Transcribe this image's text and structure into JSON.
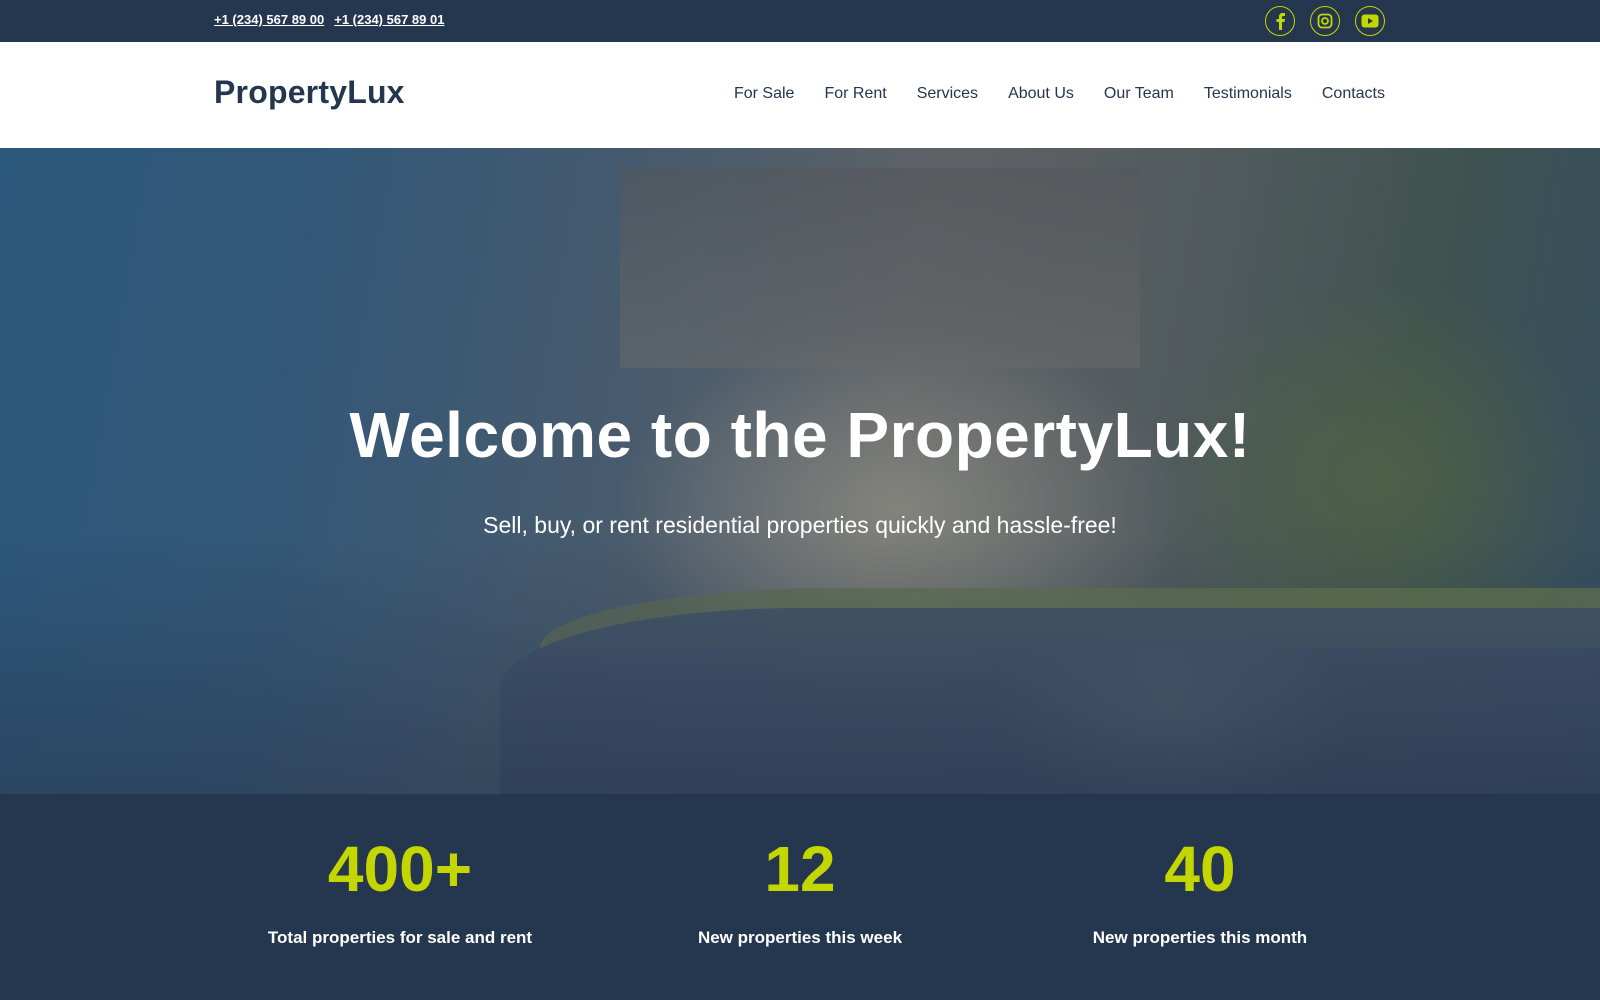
{
  "topbar": {
    "phones": [
      "+1 (234) 567 89 00",
      "+1 (234) 567 89 01"
    ],
    "socials": [
      {
        "name": "facebook",
        "icon": "facebook-icon"
      },
      {
        "name": "instagram",
        "icon": "instagram-icon"
      },
      {
        "name": "youtube",
        "icon": "youtube-icon"
      }
    ]
  },
  "header": {
    "logo": "PropertyLux",
    "nav": [
      "For Sale",
      "For Rent",
      "Services",
      "About Us",
      "Our Team",
      "Testimonials",
      "Contacts"
    ]
  },
  "hero": {
    "title": "Welcome to the PropertyLux!",
    "subtitle": "Sell, buy, or rent residential properties quickly and hassle-free!"
  },
  "stats": [
    {
      "value": "400+",
      "label": "Total properties for sale and rent"
    },
    {
      "value": "12",
      "label": "New properties this week"
    },
    {
      "value": "40",
      "label": "New properties this month"
    }
  ],
  "colors": {
    "primary": "#24374f",
    "accent": "#c4d600",
    "white": "#ffffff"
  }
}
